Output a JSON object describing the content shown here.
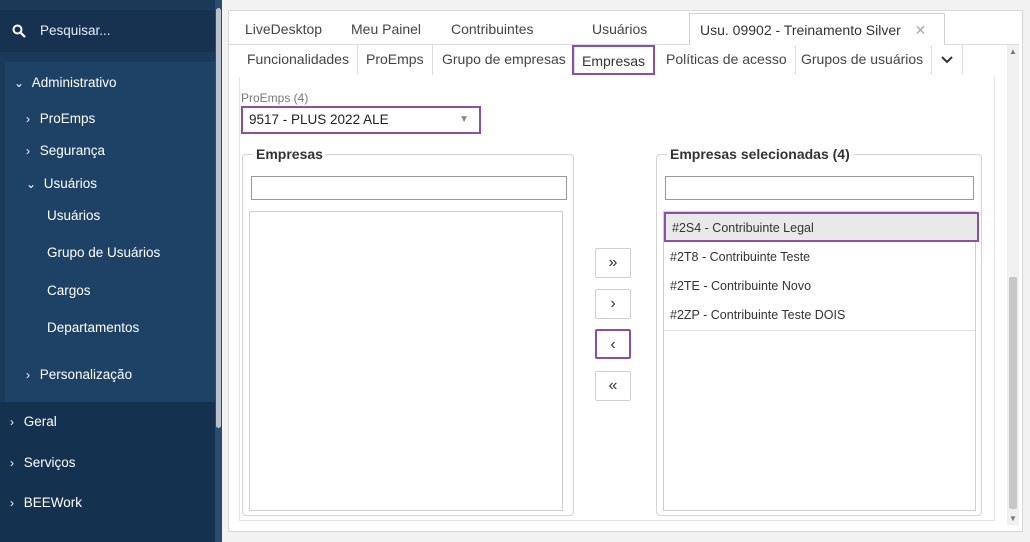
{
  "sidebar": {
    "search_label": "Pesquisar...",
    "admin": "Administrativo",
    "proemps": "ProEmps",
    "seguranca": "Segurança",
    "usuarios_group": "Usuários",
    "usuarios": "Usuários",
    "grupo_usuarios": "Grupo de Usuários",
    "cargos": "Cargos",
    "departamentos": "Departamentos",
    "personalizacao": "Personalização",
    "geral": "Geral",
    "servicos": "Serviços",
    "beework": "BEEWork"
  },
  "tabs_top": [
    {
      "label": "LiveDesktop"
    },
    {
      "label": "Meu Painel"
    },
    {
      "label": "Contribuintes"
    },
    {
      "label": "Usuários"
    },
    {
      "label": "Usu. 09902 - Treinamento Silver"
    }
  ],
  "tabs_sub": [
    {
      "label": "Funcionalidades"
    },
    {
      "label": "ProEmps"
    },
    {
      "label": "Grupo de empresas"
    },
    {
      "label": "Empresas"
    },
    {
      "label": "Políticas de acesso"
    },
    {
      "label": "Grupos de usuários"
    }
  ],
  "proemps": {
    "label": "ProEmps (4)",
    "selected": "9517 - PLUS 2022 ALE"
  },
  "left_panel": {
    "title": "Empresas",
    "filter_value": ""
  },
  "right_panel": {
    "title": "Empresas selecionadas (4)",
    "filter_value": "",
    "items": [
      {
        "label": "#2S4 - Contribuinte Legal"
      },
      {
        "label": "#2T8 - Contribuinte Teste"
      },
      {
        "label": "#2TE - Contribuinte Novo"
      },
      {
        "label": "#2ZP - Contribuinte Teste DOIS"
      }
    ]
  },
  "buttons": {
    "move_all_right": "»",
    "move_right": "›",
    "move_left": "‹",
    "move_all_left": "«"
  },
  "colors": {
    "sidebar_bg": "#1b3a59",
    "highlight": "#8e4ea3"
  }
}
